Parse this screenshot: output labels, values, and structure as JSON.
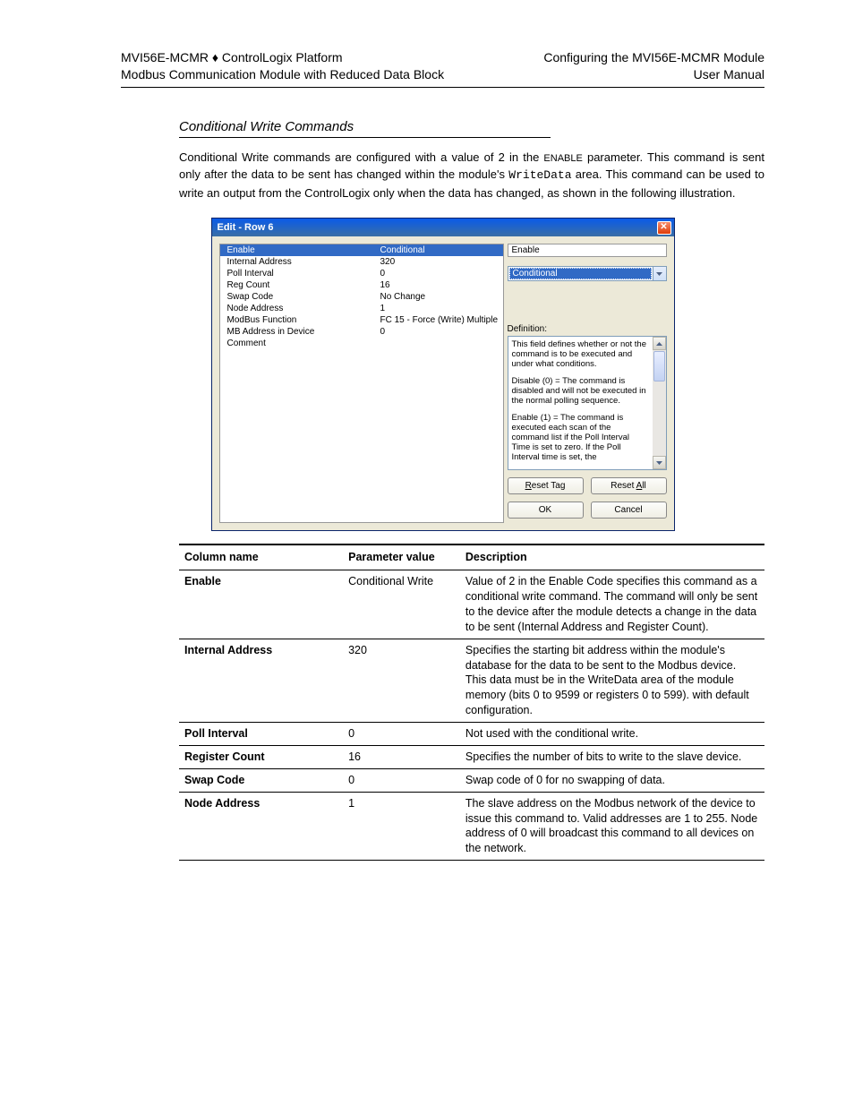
{
  "header": {
    "left_line1": "MVI56E-MCMR ♦ ControlLogix Platform",
    "left_line2": "Modbus Communication Module with Reduced Data Block",
    "right_line1": "Configuring the MVI56E-MCMR Module",
    "right_line2": "User Manual"
  },
  "section_title": "Conditional Write Commands",
  "para1_prefix": "Conditional Write commands are configured with a value of 2 in the ",
  "para1_small": "ENABLE",
  "para1_mid": " parameter. This command is sent only after the data to be sent has changed within the module's ",
  "para1_mono": "WriteData",
  "para1_suffix": " area. This command can be used to write an output from the ControlLogix only when the data has changed, as shown in the following illustration.",
  "dialog": {
    "title": "Edit - Row 6",
    "close_glyph": "✕",
    "list": [
      {
        "label": "Enable",
        "value": "Conditional",
        "selected": true
      },
      {
        "label": "Internal Address",
        "value": "320"
      },
      {
        "label": "Poll Interval",
        "value": "0"
      },
      {
        "label": "Reg Count",
        "value": "16"
      },
      {
        "label": "Swap Code",
        "value": "No Change"
      },
      {
        "label": "Node Address",
        "value": "1"
      },
      {
        "label": "ModBus Function",
        "value": "FC 15 - Force (Write) Multiple"
      },
      {
        "label": "MB Address in Device",
        "value": "0"
      },
      {
        "label": "Comment",
        "value": ""
      }
    ],
    "right_label": "Enable",
    "right_select": "Conditional",
    "def_label": "Definition:",
    "def_p1": "This field defines whether or not the command is to be executed and under what conditions.",
    "def_p2": "Disable (0) = The command is disabled and will not be executed in the normal polling sequence.",
    "def_p3": "Enable (1) = The command is executed each scan of the command list if the Poll Interval Time is set to zero. If the Poll Interval time is set, the",
    "btn_reset_tag_pre": "R",
    "btn_reset_tag_rest": "eset Tag",
    "btn_reset_all_pre": "Reset ",
    "btn_reset_all_u": "A",
    "btn_reset_all_rest": "ll",
    "btn_ok": "OK",
    "btn_cancel": "Cancel"
  },
  "table": {
    "hdr1": "Column name",
    "hdr2": "Parameter value",
    "hdr3": "Description",
    "rows": [
      {
        "c1": "Enable",
        "c2": "Conditional Write",
        "c3": "Value of 2 in the Enable Code specifies this command as a conditional write command. The command will only be sent to the device after the module detects a change in the data to be sent (Internal Address and Register Count)."
      },
      {
        "c1": "Internal Address",
        "c2": "320",
        "c3": "Specifies the starting bit address within the module's database for the data to be sent to the Modbus device. This data must be in the WriteData area of the module memory (bits 0 to 9599 or registers 0 to 599). with default configuration."
      },
      {
        "c1": "Poll Interval",
        "c2": "0",
        "c3": "Not used with the conditional write."
      },
      {
        "c1": "Register Count",
        "c2": "16",
        "c3": "Specifies the number of bits to write to the slave device."
      },
      {
        "c1": "Swap Code",
        "c2": "0",
        "c3": "Swap code of 0 for no swapping of data."
      },
      {
        "c1": "Node Address",
        "c2": "1",
        "c3": "The slave address on the Modbus network of the device to issue this command to. Valid addresses are 1 to 255. Node address of 0 will broadcast this command to all devices on the network."
      }
    ]
  }
}
